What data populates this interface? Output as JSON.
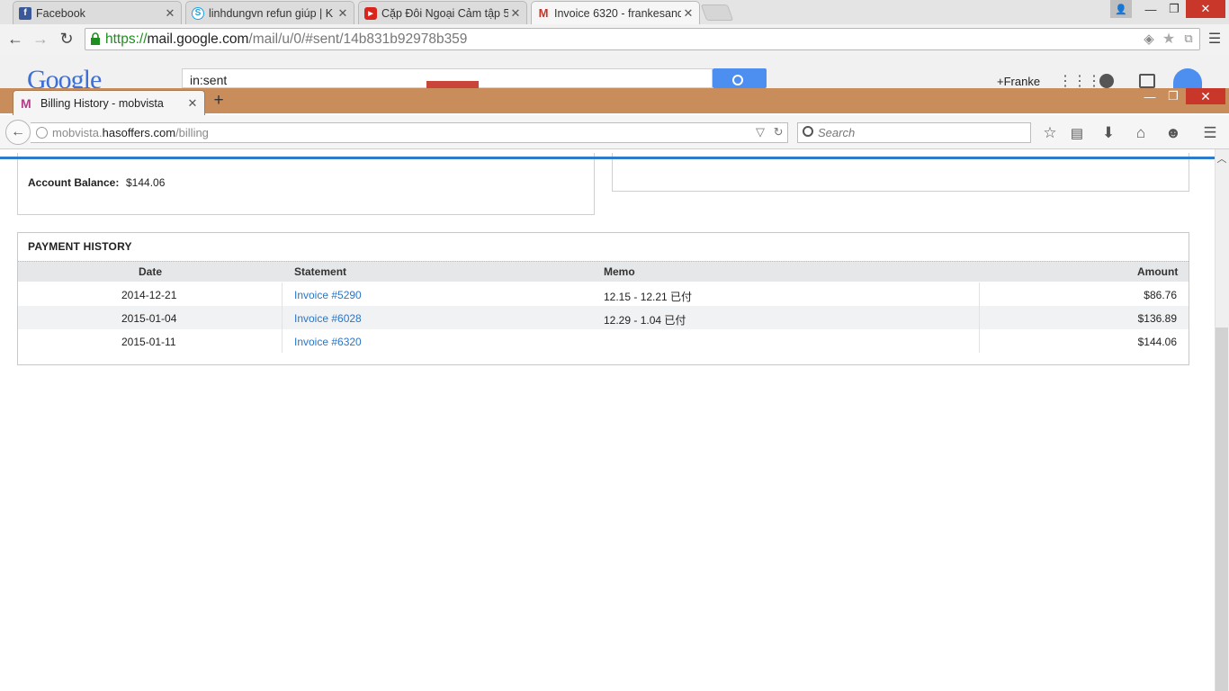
{
  "chrome": {
    "tabs": [
      {
        "title": "Facebook",
        "icon": "facebook-icon",
        "color": "#3b5998"
      },
      {
        "title": "linhdungvn refun giúp | K",
        "icon": "skype-icon",
        "color": "#1da1e2"
      },
      {
        "title": "Cặp Đôi Ngoại Cảm tập 5",
        "icon": "youtube-icon",
        "color": "#d9261c"
      },
      {
        "title": "Invoice 6320 - frankesand",
        "icon": "gmail-icon",
        "color": "#c5372c"
      }
    ],
    "url": {
      "scheme": "https://",
      "host": "mail.google.com",
      "path": "/mail/u/0/#sent/14b831b92978b359"
    }
  },
  "gmail": {
    "logo": "Google",
    "search_value": "in:sent",
    "user": "+Franke"
  },
  "firefox": {
    "tab_title": "Billing History - mobvista",
    "url": {
      "sub": "mobvista.",
      "host": "hasoffers.com",
      "path": "/billing"
    },
    "search_placeholder": "Search"
  },
  "account": {
    "balance_label": "Account Balance:",
    "balance_value": "$144.06"
  },
  "payment_history": {
    "title": "PAYMENT HISTORY",
    "headers": {
      "date": "Date",
      "statement": "Statement",
      "memo": "Memo",
      "amount": "Amount"
    },
    "rows": [
      {
        "date": "2014-12-21",
        "statement": "Invoice #5290",
        "memo": "12.15 - 12.21 已付",
        "amount": "$86.76"
      },
      {
        "date": "2015-01-04",
        "statement": "Invoice #6028",
        "memo": "12.29 - 1.04 已付",
        "amount": "$136.89"
      },
      {
        "date": "2015-01-11",
        "statement": "Invoice #6320",
        "memo": "",
        "amount": "$144.06"
      }
    ]
  }
}
